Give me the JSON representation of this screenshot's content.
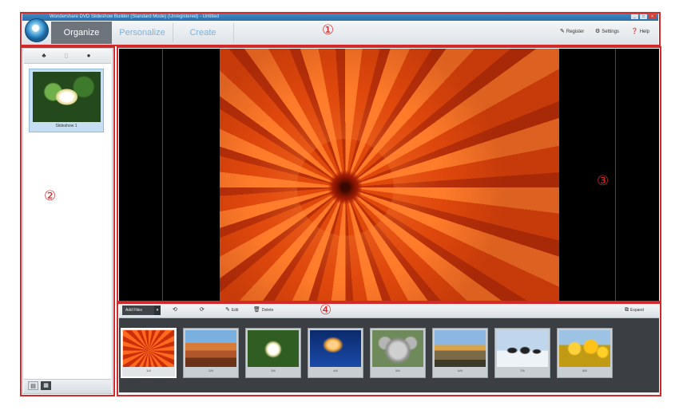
{
  "window": {
    "title": "Wondershare DVD Slideshow Builder (Standard Mode) (Unregistered) - Untitled",
    "controls": [
      "_",
      "□",
      "×"
    ]
  },
  "toolbar": {
    "tabs": [
      {
        "label": "Organize",
        "active": true
      },
      {
        "label": "Personalize",
        "active": false
      },
      {
        "label": "Create",
        "active": false
      }
    ],
    "links": [
      {
        "icon": "key-icon",
        "label": "Register"
      },
      {
        "icon": "gear-icon",
        "label": "Settings"
      },
      {
        "icon": "help-icon",
        "label": "Help"
      }
    ]
  },
  "left_panel": {
    "album_name": "Slideshow 1"
  },
  "filmstrip_toolbar": {
    "select_value": "Add Files",
    "buttons": [
      "",
      "",
      "Edit",
      "Delete"
    ],
    "expand_label": "Expand"
  },
  "filmstrip": {
    "thumbnails": [
      {
        "label": "1/4",
        "subject": "orange chrysanthemum",
        "selected": true
      },
      {
        "label": "2/4",
        "subject": "desert canyon"
      },
      {
        "label": "3/4",
        "subject": "white hydrangea"
      },
      {
        "label": "4/4",
        "subject": "jellyfish"
      },
      {
        "label": "5/4",
        "subject": "koala"
      },
      {
        "label": "6/4",
        "subject": "lighthouse"
      },
      {
        "label": "7/4",
        "subject": "penguins"
      },
      {
        "label": "8/4",
        "subject": "tulips"
      }
    ]
  },
  "callouts": [
    "①",
    "②",
    "③",
    "④"
  ],
  "colors": {
    "annotation_red": "#d22a2a",
    "title_bar": "#2a6ea8",
    "active_tab": "#6d747b",
    "viewer_bg": "#000000",
    "filmstrip_bg": "#3b3f43"
  }
}
